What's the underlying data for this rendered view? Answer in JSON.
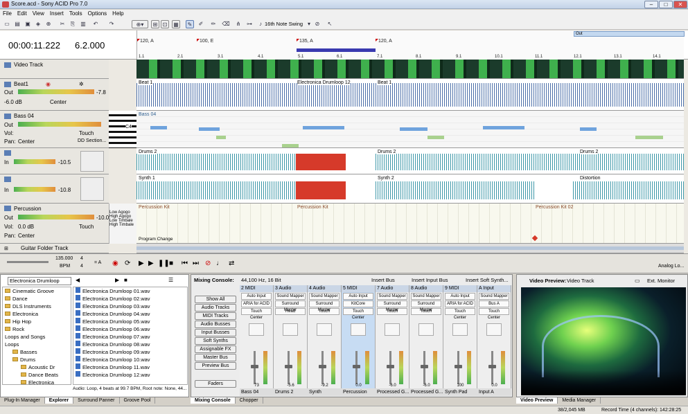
{
  "window": {
    "title": "Score.acd - Sony ACID Pro 7.0"
  },
  "menu": [
    "File",
    "Edit",
    "View",
    "Insert",
    "Tools",
    "Options",
    "Help"
  ],
  "toolbar": {
    "swing": "16th Note Swing"
  },
  "time": {
    "position": "00:00:11.222",
    "measure": "6.2.000"
  },
  "markers": [
    {
      "label": "120, A"
    },
    {
      "label": "100, E"
    },
    {
      "label": "135, A"
    },
    {
      "label": "120, A"
    }
  ],
  "ruler": [
    "1.1",
    "2.1",
    "3.1",
    "4.1",
    "5.1",
    "6.1",
    "7.1",
    "8.1",
    "9.1",
    "10.1",
    "11.1",
    "12.1",
    "13.1",
    "14.1"
  ],
  "region_label": "Out",
  "tracks": [
    {
      "name": "Video Track"
    },
    {
      "name": "Beat1",
      "out": "Out",
      "db": "-6.0 dB",
      "pan": "Center",
      "meter": "-7.8"
    },
    {
      "name": "Bass 04",
      "out": "Out",
      "vol_label": "Vol:",
      "vol": "Touch",
      "pan_label": "Pan:",
      "pan": "Center",
      "extra": "DD Section...",
      "note": "C4"
    },
    {
      "name": "",
      "in": "In",
      "meter": "-10.5"
    },
    {
      "name": "",
      "in": "In",
      "meter": "-10.8"
    },
    {
      "name": "Percussion",
      "out": "Out",
      "vol_label": "Vol:",
      "vol": "0.0 dB",
      "vol_mode": "Touch",
      "pan_label": "Pan:",
      "pan": "Center",
      "meter": "-10.0"
    },
    {
      "name": "Guitar Folder Track"
    }
  ],
  "clips": {
    "beat1": [
      "Beat 1",
      "Electronica Drumloop 12",
      "Beat 1"
    ],
    "bass": "Bass 04",
    "drums": [
      "Drums 2",
      "Drums 2",
      "Drums 2"
    ],
    "synth": [
      "Synth 1",
      "Synth 2",
      "Distortion"
    ],
    "perc": [
      "Percussion Kit",
      "Percussion Kit",
      "Percussion Kit 02"
    ],
    "perc_labels": [
      "Low Agogo",
      "High Agogo",
      "Low Timbale",
      "High Timbale"
    ],
    "program_change": "Program Change"
  },
  "transport": {
    "tempo": "135.000",
    "bpm_label": "BPM",
    "ts_top": "4",
    "ts_bottom": "4",
    "key": "= A",
    "analog": "Analog Lo..."
  },
  "explorer": {
    "path": "Electronica Drumloop",
    "folders": [
      "Cinematic Groove",
      "Dance",
      "DLS Instruments",
      "Electronica",
      "Hip Hop",
      "Rock",
      "Loops and Songs",
      "Loops",
      "Basses",
      "Drums",
      "Acoustic Dr",
      "Dance Beats",
      "Electronica",
      "Old School"
    ],
    "files": [
      "Electronica Drumloop 01.wav",
      "Electronica Drumloop 02.wav",
      "Electronica Drumloop 03.wav",
      "Electronica Drumloop 04.wav",
      "Electronica Drumloop 05.wav",
      "Electronica Drumloop 06.wav",
      "Electronica Drumloop 07.wav",
      "Electronica Drumloop 08.wav",
      "Electronica Drumloop 09.wav",
      "Electronica Drumloop 10.wav",
      "Electronica Drumloop 11.wav",
      "Electronica Drumloop 12.wav"
    ],
    "files_col2": "Electronica",
    "status": "Audio: Loop, 4 beats at 99.7 BPM, Root note: None, 44..."
  },
  "left_tabs": [
    "Plug-In Manager",
    "Explorer",
    "Surround Panner",
    "Groove Pool"
  ],
  "mixer": {
    "title": "Mixing Console:",
    "format": "44,100 Hz, 16 Bit",
    "buttons": [
      "Insert Bus",
      "Insert Input Bus",
      "Insert Soft Synth..."
    ],
    "side": [
      "Show All",
      "Audio Tracks",
      "MIDI Tracks",
      "Audio Busses",
      "Input Busses",
      "Soft Synths",
      "Assignable FX",
      "Master Bus",
      "Preview Bus",
      "Faders"
    ],
    "strips": [
      {
        "num": "2",
        "type": "MIDI",
        "in": "Auto Input",
        "dev": "ARIA for ACID",
        "mode": "Touch",
        "pan": "Center",
        "val": "73",
        "name": "Bass 04"
      },
      {
        "num": "3",
        "type": "Audio",
        "in": "Sound Mapper",
        "dev": "Surround Master",
        "mode": "Read",
        "pan": "",
        "val": "-5.6",
        "name": "Drums 2"
      },
      {
        "num": "4",
        "type": "Audio",
        "in": "Sound Mapper",
        "dev": "Surround Master",
        "mode": "Touch",
        "pan": "",
        "val": "-9.2",
        "name": "Synth"
      },
      {
        "num": "5",
        "type": "MIDI",
        "in": "Auto Input",
        "dev": "KitCore",
        "mode": "Touch",
        "pan": "Center",
        "val": "0.0",
        "name": "Percussion"
      },
      {
        "num": "7",
        "type": "Audio",
        "in": "Sound Mapper",
        "dev": "Surround Master",
        "mode": "Touch",
        "pan": "",
        "val": "-6.0",
        "name": "Processed G..."
      },
      {
        "num": "8",
        "type": "Audio",
        "in": "Sound Mapper",
        "dev": "Surround Master",
        "mode": "Touch",
        "pan": "",
        "val": "-6.0",
        "name": "Processed G..."
      },
      {
        "num": "9",
        "type": "MIDI",
        "in": "Auto Input",
        "dev": "ARIA for ACID",
        "mode": "Touch",
        "pan": "Center",
        "val": "100",
        "name": "Synth Pad"
      },
      {
        "num": "A",
        "type": "Input",
        "in": "Sound Mapper",
        "dev": "Bus A",
        "mode": "Touch",
        "pan": "Center",
        "val": "0.0",
        "name": "Input A"
      }
    ]
  },
  "mid_tabs": [
    "Mixing Console",
    "Chopper"
  ],
  "video": {
    "title": "Video Preview:",
    "track": "Video Track",
    "monitor": "Ext. Monitor"
  },
  "right_tabs": [
    "Video Preview",
    "Media Manager"
  ],
  "status": {
    "memory": "38/2,045 MB",
    "record": "Record Time (4 channels): 142:28:25"
  },
  "colors": {
    "accent": "#4a6ea8",
    "red": "#d63a2a",
    "green": "#59a75b",
    "mixer_sel": "#c7dcf3"
  }
}
